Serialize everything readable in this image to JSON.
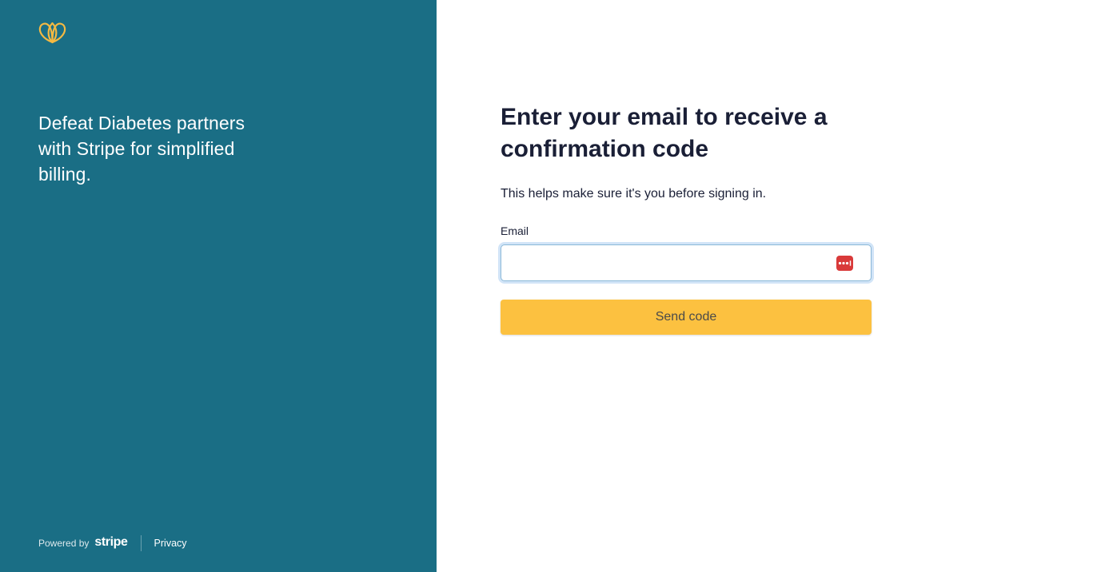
{
  "brand": {
    "logo_icon": "double-loop-heart-logo",
    "accent_color": "#f4b942",
    "panel_color": "#1a6e85"
  },
  "left_panel": {
    "tagline": "Defeat Diabetes partners with Stripe for simplified billing."
  },
  "footer": {
    "powered_by": "Powered by",
    "stripe_logo": "stripe",
    "privacy_link": "Privacy"
  },
  "form": {
    "heading": "Enter your email to receive a confirmation code",
    "subtext": "This helps make sure it's you before signing in.",
    "email_label": "Email",
    "email_value": "",
    "email_placeholder": "",
    "password_manager_icon": "password-dots-icon",
    "send_button_label": "Send code",
    "button_color": "#fcc140"
  }
}
